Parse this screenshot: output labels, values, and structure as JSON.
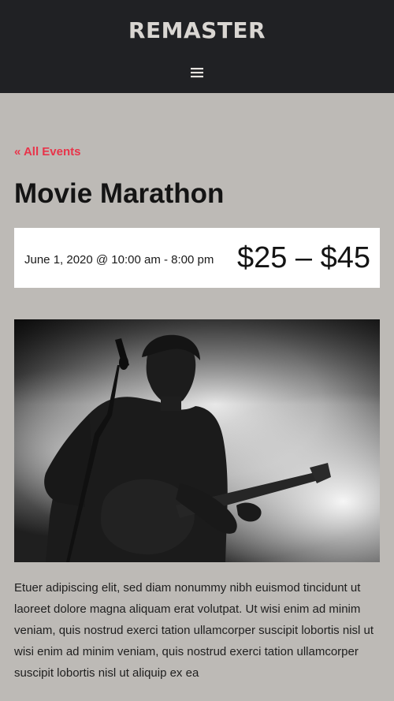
{
  "header": {
    "site_title": "REMASTER",
    "menu_icon": "hamburger-menu-icon"
  },
  "event": {
    "back_link": "« All Events",
    "title": "Movie Marathon",
    "datetime": "June 1, 2020 @ 10:00 am - 8:00 pm",
    "price": "$25 – $45",
    "image_subject": "guitarist-with-microphone-photo",
    "description": "Etuer adipiscing elit, sed diam nonummy nibh euismod tincidunt ut laoreet dolore magna aliquam erat volutpat. Ut wisi enim ad minim veniam, quis nostrud exerci tation ullamcorper suscipit lobortis nisl ut wisi enim ad minim veniam, quis nostrud exerci tation ullamcorper suscipit lobortis nisl ut aliquip ex ea"
  },
  "colors": {
    "header_bg": "#202124",
    "page_bg": "#bdbab6",
    "accent": "#e8344a",
    "text": "#141414",
    "meta_bg": "#ffffff"
  }
}
